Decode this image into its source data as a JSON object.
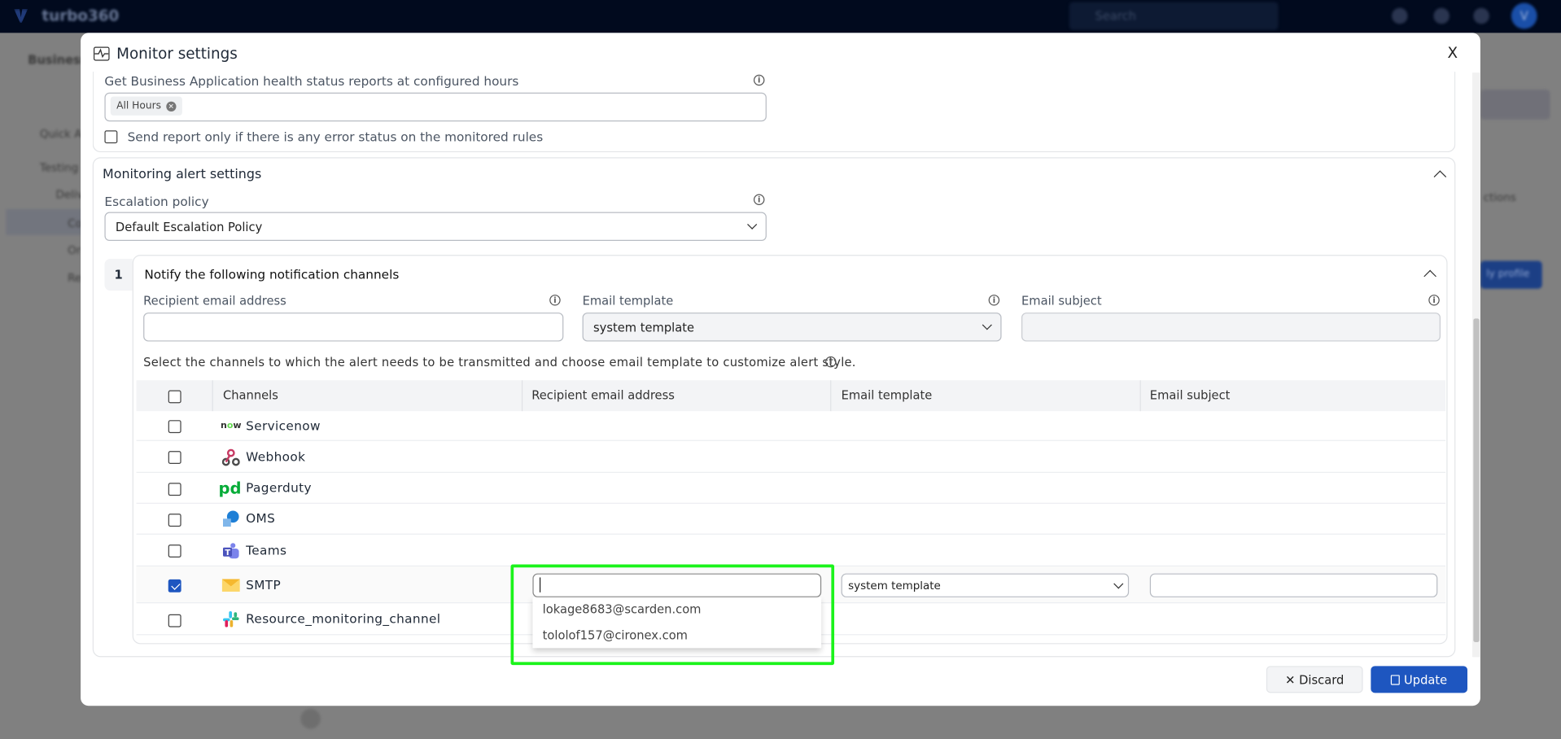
{
  "app": {
    "logo": "turbo360",
    "search_placeholder": "Search",
    "avatar_initial": "V"
  },
  "background": {
    "page_title": "Business",
    "tree": [
      "Quick A",
      "Testing",
      "Deliv",
      "Co",
      "Or",
      "Re"
    ],
    "right_button": "ly profile",
    "right_header": "ctions"
  },
  "modal": {
    "title": "Monitor settings",
    "close_label": "X",
    "report": {
      "label": "Get Business Application health status reports at configured hours",
      "chips": [
        "All Hours"
      ],
      "error_only_label": "Send report only if there is any error status on the monitored rules",
      "error_only_checked": false
    },
    "alert": {
      "title": "Monitoring alert settings",
      "escalation_label": "Escalation policy",
      "escalation_value": "Default Escalation Policy",
      "step": {
        "number": "1",
        "title": "Notify the following notification channels",
        "recipient_label": "Recipient email address",
        "recipient_value": "",
        "template_label": "Email template",
        "template_value": "system template",
        "subject_label": "Email subject",
        "subject_value": "",
        "description": "Select the channels to which the alert needs to be transmitted and choose email template to customize alert style.",
        "columns": [
          "Channels",
          "Recipient email address",
          "Email template",
          "Email subject"
        ],
        "channels": [
          {
            "name": "Servicenow",
            "icon": "servicenow-icon",
            "checked": false
          },
          {
            "name": "Webhook",
            "icon": "webhook-icon",
            "checked": false
          },
          {
            "name": "Pagerduty",
            "icon": "pagerduty-icon",
            "checked": false
          },
          {
            "name": "OMS",
            "icon": "oms-icon",
            "checked": false
          },
          {
            "name": "Teams",
            "icon": "teams-icon",
            "checked": false
          },
          {
            "name": "SMTP",
            "icon": "mail-icon",
            "checked": true,
            "recipient": "",
            "template": "system template",
            "subject": ""
          },
          {
            "name": "Resource_monitoring_channel",
            "icon": "slack-icon",
            "checked": false
          }
        ],
        "suggestions": [
          "lokage8683@scarden.com",
          "tololof157@cironex.com"
        ]
      }
    },
    "footer": {
      "discard": "✕ Discard",
      "update": "Update"
    }
  },
  "colors": {
    "primary": "#1e56c0",
    "highlight": "#1bf31b",
    "navbar": "#010a1e"
  }
}
